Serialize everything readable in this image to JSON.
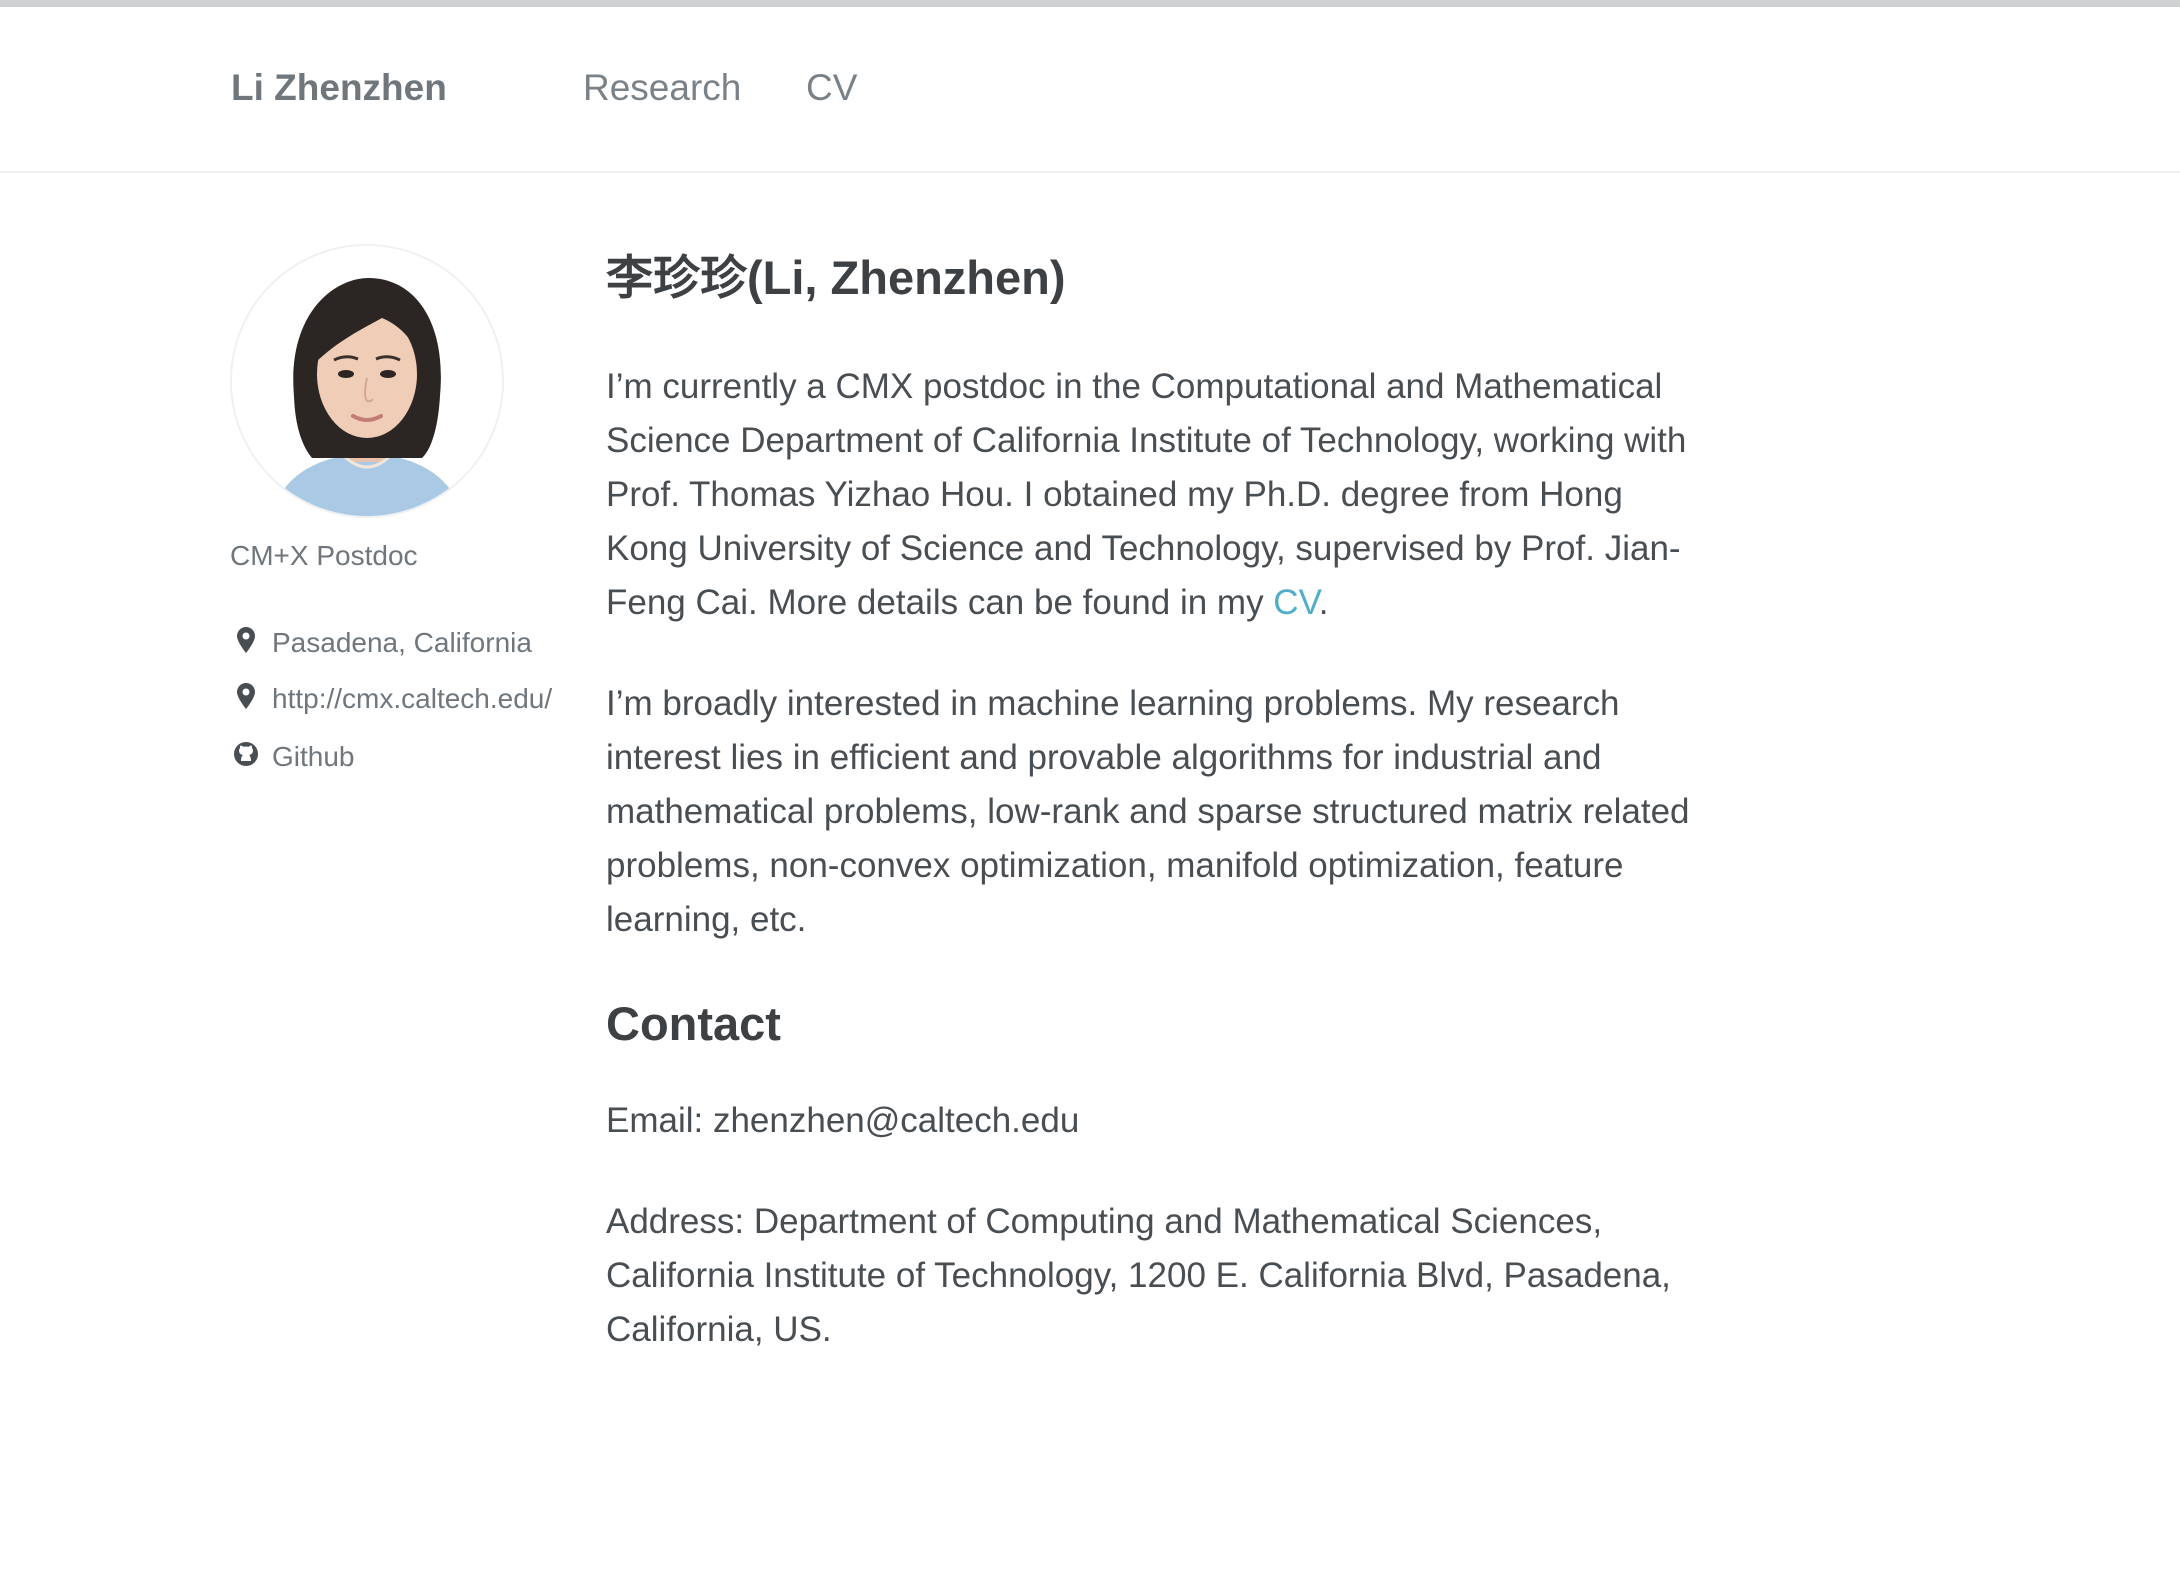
{
  "masthead": {
    "site_title": "Li Zhenzhen",
    "nav": [
      {
        "label": "Research"
      },
      {
        "label": "CV"
      }
    ]
  },
  "sidebar": {
    "bio": "CM+X Postdoc",
    "links": [
      {
        "icon": "location-pin-icon",
        "label": "Pasadena, California"
      },
      {
        "icon": "location-pin-icon",
        "label": "http://cmx.caltech.edu/"
      },
      {
        "icon": "github-icon",
        "label": "Github"
      }
    ]
  },
  "main": {
    "title": "李珍珍(Li, Zhenzhen)",
    "intro_text": "I’m currently a CMX postdoc in the Computational and Mathematical Science Department of California Institute of Technology, working with Prof. Thomas Yizhao Hou. I obtained my Ph.D. degree from Hong Kong University of Science and Technology, supervised by Prof. Jian-Feng Cai. More details can be found in my ",
    "intro_link": "CV",
    "intro_end": ".",
    "interests": "I’m broadly interested in machine learning problems. My research interest lies in efficient and provable algorithms for industrial and mathematical problems, low-rank and sparse structured matrix related problems, non-convex optimization, manifold optimization, feature learning, etc.",
    "contact_heading": "Contact",
    "email": "Email: zhenzhen@caltech.edu",
    "address": "Address: Department of Computing and Mathematical Sciences, California Institute of Technology, 1200 E. California Blvd, Pasadena, California, US."
  },
  "colors": {
    "text": "#494e52",
    "heading": "#3d4144",
    "muted": "#6f777d",
    "link": "#52adc8",
    "border": "#eef0f2"
  }
}
